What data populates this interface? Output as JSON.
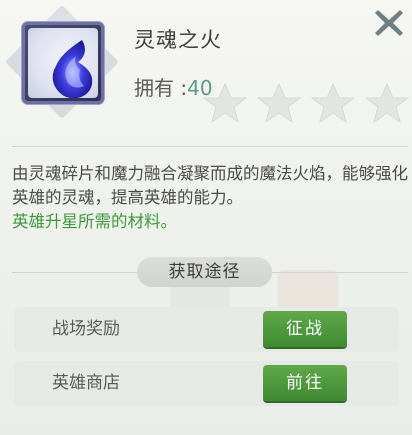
{
  "item": {
    "name": "灵魂之火",
    "own_label": "拥有 :",
    "own_count": "40",
    "star_count": 4
  },
  "description": {
    "main": "由灵魂碎片和魔力融合凝聚而成的魔法火焰，能够强化英雄的灵魂，提高英雄的能力。",
    "highlight": "英雄升星所需的材料。"
  },
  "sources": {
    "header": "获取途径",
    "rows": [
      {
        "label": "战场奖励",
        "button": "征战"
      },
      {
        "label": "英雄商店",
        "button": "前往"
      }
    ]
  },
  "colors": {
    "accent_green": "#3e9a3e",
    "count_teal": "#5a9a86",
    "button_green": "#4f9a3d"
  },
  "icons": [
    "close-icon",
    "soul-fire-icon",
    "star-icon"
  ]
}
